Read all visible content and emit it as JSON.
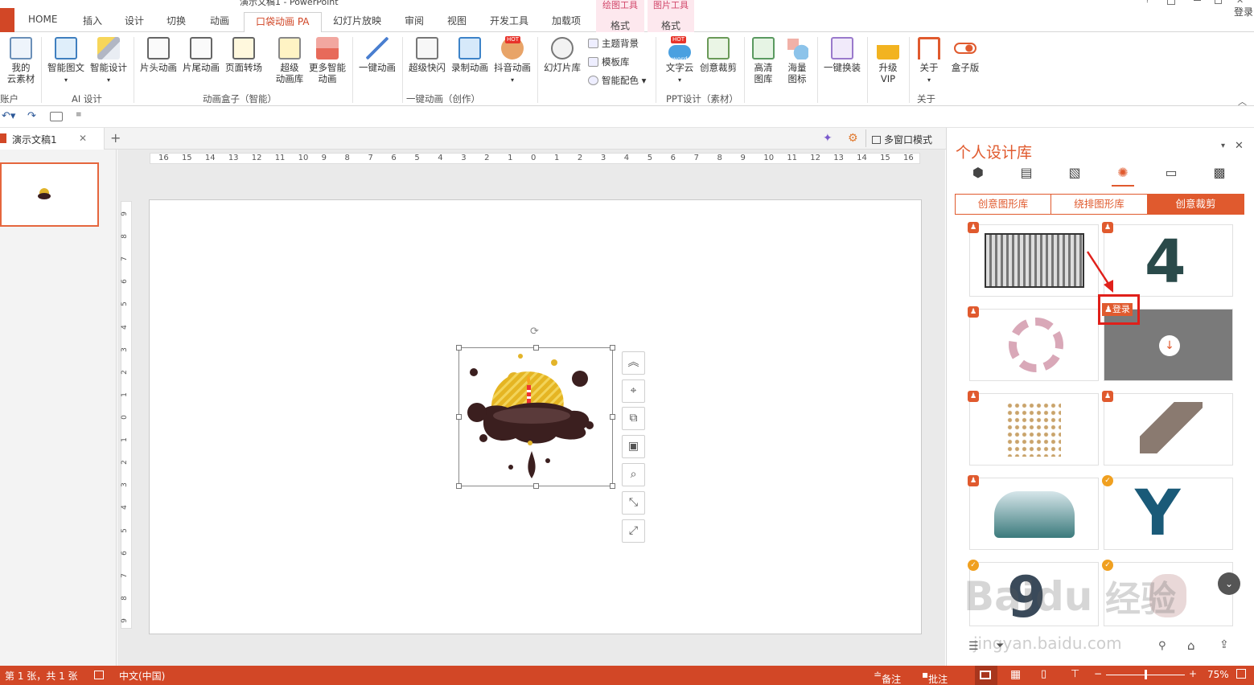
{
  "window": {
    "title": "演示文稿1 - PowerPoint",
    "login": "登录"
  },
  "tabs": [
    "HOME",
    "插入",
    "设计",
    "切换",
    "动画",
    "口袋动画 PA",
    "幻灯片放映",
    "审阅",
    "视图",
    "开发工具",
    "加载项"
  ],
  "context_tabs": [
    {
      "group": "绘图工具",
      "tab": "格式"
    },
    {
      "group": "图片工具",
      "tab": "格式"
    }
  ],
  "ribbon": {
    "buttons": [
      {
        "label": "我的\n云素材"
      },
      {
        "label": "智能图文"
      },
      {
        "label": "智能设计"
      },
      {
        "label": "片头动画"
      },
      {
        "label": "片尾动画"
      },
      {
        "label": "页面转场"
      },
      {
        "label": "超级\n动画库"
      },
      {
        "label": "更多智能\n动画"
      },
      {
        "label": "一键动画"
      },
      {
        "label": "超级快闪"
      },
      {
        "label": "录制动画"
      },
      {
        "label": "抖音动画"
      },
      {
        "label": "幻灯片库"
      },
      {
        "label": "文字云"
      },
      {
        "label": "创意裁剪"
      },
      {
        "label": "高清\n图库"
      },
      {
        "label": "海量\n图标"
      },
      {
        "label": "一键换装"
      },
      {
        "label": "升级\nVIP"
      },
      {
        "label": "关于"
      },
      {
        "label": "盒子版"
      }
    ],
    "small_buttons": [
      "主题背景",
      "模板库",
      "智能配色"
    ],
    "groups": [
      "账户",
      "AI 设计",
      "动画盒子（智能）",
      "一键动画（创作）",
      "PPT设计（素材）",
      "关于"
    ],
    "hot": "HOT",
    "word": "word"
  },
  "doc_tab": {
    "name": "演示文稿1",
    "close": "✕",
    "add": "+"
  },
  "doc_tools": {
    "multi_window": "多窗口模式"
  },
  "ruler": {
    "h": [
      "16",
      "15",
      "14",
      "13",
      "12",
      "11",
      "10",
      "9",
      "8",
      "7",
      "6",
      "5",
      "4",
      "3",
      "2",
      "1",
      "0",
      "1",
      "2",
      "3",
      "4",
      "5",
      "6",
      "7",
      "8",
      "9",
      "10",
      "11",
      "12",
      "13",
      "14",
      "15",
      "16"
    ],
    "v": [
      "9",
      "8",
      "7",
      "6",
      "5",
      "4",
      "3",
      "2",
      "1",
      "0",
      "1",
      "2",
      "3",
      "4",
      "5",
      "6",
      "7",
      "8",
      "9"
    ]
  },
  "panel": {
    "title": "个人设计库",
    "tabs": [
      "创意图形库",
      "绕排图形库",
      "创意裁剪"
    ],
    "active_tab": 2,
    "login_label": "登录",
    "cards": [
      {
        "badge": "p"
      },
      {
        "badge": "p"
      },
      {
        "badge": "p"
      },
      {
        "badge": "none"
      },
      {
        "badge": "p"
      },
      {
        "badge": "p"
      },
      {
        "badge": "p"
      },
      {
        "badge": "v"
      },
      {
        "badge": "v"
      },
      {
        "badge": "v"
      }
    ]
  },
  "watermark": {
    "brand": "Baidu",
    "cn": "经验",
    "url": "jingyan.baidu.com"
  },
  "status": {
    "slide_info": "第 1 张，共 1 张",
    "language": "中文(中国)",
    "notes": "备注",
    "comments": "批注",
    "zoom": "75%",
    "zoom_level": 0.5
  },
  "colors": {
    "accent": "#d24726",
    "panel_accent": "#e05a2e",
    "context_tab": "#d2496c"
  }
}
